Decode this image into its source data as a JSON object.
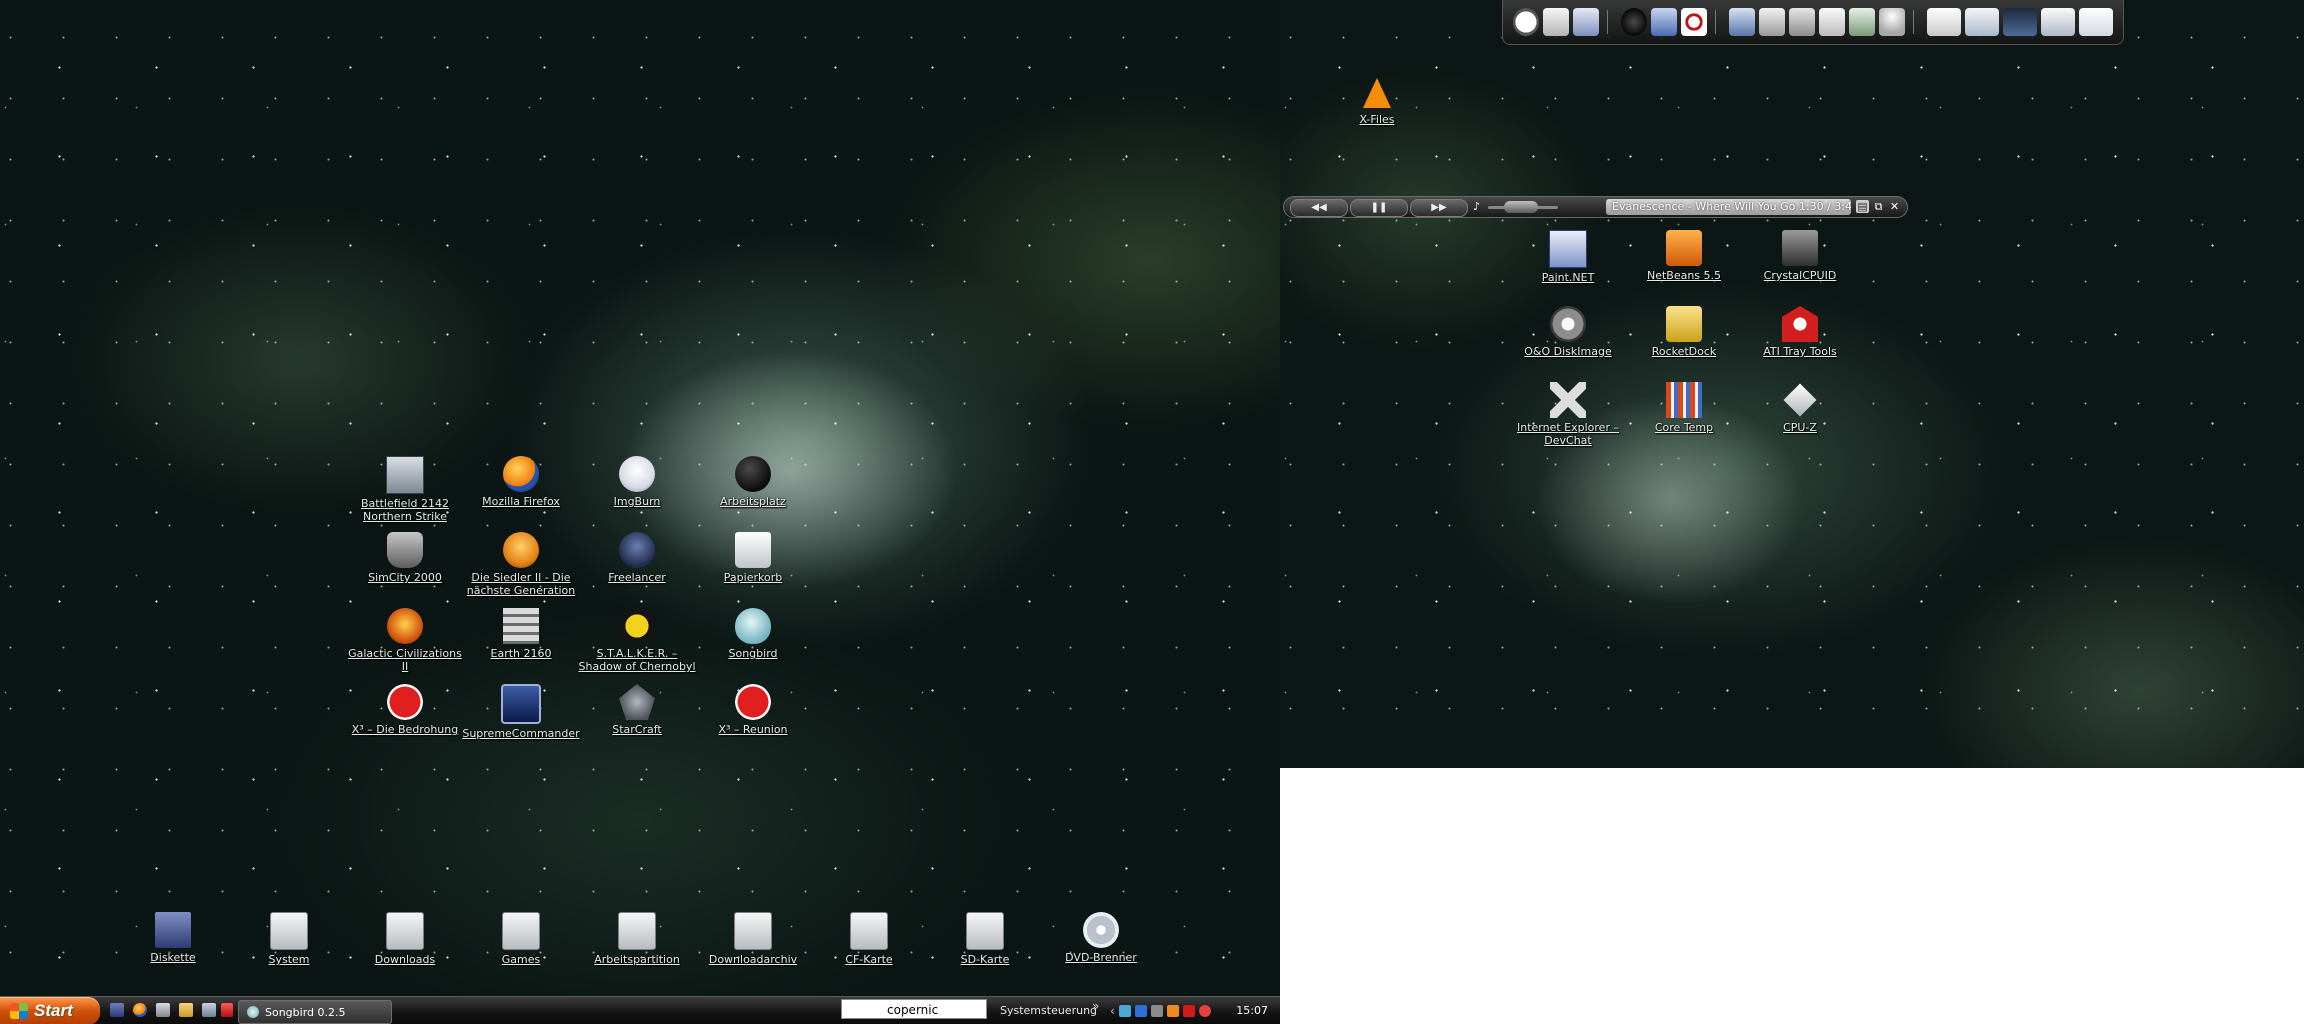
{
  "desktop_left": {
    "grid_icons": [
      {
        "label": "Battlefield 2142 Northern Strike",
        "icon": "battlefield-icon"
      },
      {
        "label": "Mozilla Firefox",
        "icon": "firefox-icon"
      },
      {
        "label": "ImgBurn",
        "icon": "imgburn-icon"
      },
      {
        "label": "Arbeitsplatz",
        "icon": "computer-icon"
      },
      {
        "label": "SimCity 2000",
        "icon": "simcity-icon"
      },
      {
        "label": "Die Siedler II - Die nächste Generation",
        "icon": "siedler-icon"
      },
      {
        "label": "Freelancer",
        "icon": "freelancer-icon"
      },
      {
        "label": "Papierkorb",
        "icon": "recycle-bin-icon"
      },
      {
        "label": "Galactic Civilizations II",
        "icon": "galciv-icon"
      },
      {
        "label": "Earth 2160",
        "icon": "earth2160-icon"
      },
      {
        "label": "S.T.A.L.K.E.R. – Shadow of Chernobyl",
        "icon": "stalker-icon"
      },
      {
        "label": "Songbird",
        "icon": "songbird-icon"
      },
      {
        "label": "X³ – Die Bedrohung",
        "icon": "x3-icon"
      },
      {
        "label": "SupremeCommander",
        "icon": "supreme-commander-icon"
      },
      {
        "label": "StarCraft",
        "icon": "starcraft-icon"
      },
      {
        "label": "X³ – Reunion",
        "icon": "x3-reunion-icon"
      }
    ],
    "drives": [
      {
        "label": "Diskette",
        "icon": "floppy-icon"
      },
      {
        "label": "System",
        "icon": "drive-icon"
      },
      {
        "label": "Downloads",
        "icon": "drive-icon"
      },
      {
        "label": "Games",
        "icon": "drive-icon"
      },
      {
        "label": "Arbeitspartition",
        "icon": "drive-icon"
      },
      {
        "label": "Downloadarchiv",
        "icon": "drive-icon"
      },
      {
        "label": "CF-Karte",
        "icon": "drive-icon"
      },
      {
        "label": "SD-Karte",
        "icon": "drive-icon"
      },
      {
        "label": "DVD-Brenner",
        "icon": "dvd-icon"
      }
    ]
  },
  "desktop_right": {
    "xfiles": {
      "label": "X-Files",
      "icon": "vlc-icon"
    },
    "grid_icons": [
      {
        "label": "Paint.NET",
        "icon": "paintnet-icon"
      },
      {
        "label": "NetBeans 5.5",
        "icon": "netbeans-icon"
      },
      {
        "label": "CrystalCPUID",
        "icon": "crystalcpuid-icon"
      },
      {
        "label": "O&O DiskImage",
        "icon": "oo-diskimage-icon"
      },
      {
        "label": "RocketDock",
        "icon": "rocketdock-icon"
      },
      {
        "label": "ATI Tray Tools",
        "icon": "ati-tray-tools-icon"
      },
      {
        "label": "Internet Explorer – DevChat",
        "icon": "ie-devchat-icon"
      },
      {
        "label": "Core Temp",
        "icon": "coretemp-icon"
      },
      {
        "label": "CPU-Z",
        "icon": "cpuz-icon"
      }
    ]
  },
  "player": {
    "prev_glyph": "◀◀",
    "pause_glyph": "❚❚",
    "next_glyph": "▶▶",
    "now_playing": "Evanescence  -  Where Will You Go  1:30  /  3:48",
    "close_glyph": "✕",
    "restore_glyph": "⧉"
  },
  "taskbar": {
    "start_label": "Start",
    "task_label": "Songbird 0.2.5",
    "search_value": "copernic",
    "systemsteuerung_label": "Systemsteuerung",
    "chevron_glyph": "»",
    "clock": "15:07"
  },
  "colors": {
    "start_orange": "#d0510a",
    "taskbar_dark": "#141414",
    "label_text": "#e6ece8"
  }
}
